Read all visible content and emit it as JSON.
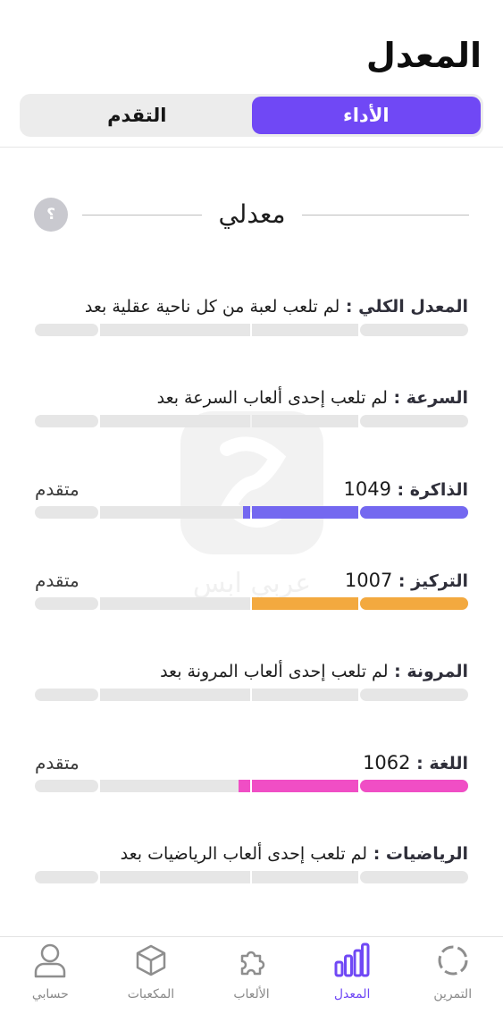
{
  "header": {
    "title": "المعدل"
  },
  "tabs": [
    {
      "id": "performance",
      "label": "الأداء",
      "active": true
    },
    {
      "id": "progress",
      "label": "التقدم",
      "active": false
    }
  ],
  "section": {
    "title": "معدلي",
    "help_label": "؟"
  },
  "watermark_text": "عربي ابس",
  "separator": " : ",
  "level_colors": {
    "empty": "#e6e6e6",
    "memory": "#7468f0",
    "focus": "#f3a93f",
    "language": "#f04ec5"
  },
  "metrics": [
    {
      "name": "المعدل الكلي",
      "value": "لم تلعب لعبة من كل ناحية عقلية بعد",
      "level": "",
      "fill": 0,
      "color": ""
    },
    {
      "name": "السرعة",
      "value": "لم تلعب إحدى ألعاب السرعة بعد",
      "level": "",
      "fill": 0,
      "color": ""
    },
    {
      "name": "الذاكرة",
      "value": "1049",
      "level": "متقدم",
      "fill": 0.52,
      "color": "#7468f0"
    },
    {
      "name": "التركيز",
      "value": "1007",
      "level": "متقدم",
      "fill": 0.5,
      "color": "#f3a93f"
    },
    {
      "name": "المرونة",
      "value": "لم تلعب إحدى ألعاب المرونة بعد",
      "level": "",
      "fill": 0,
      "color": ""
    },
    {
      "name": "اللغة",
      "value": "1062",
      "level": "متقدم",
      "fill": 0.53,
      "color": "#f04ec5"
    },
    {
      "name": "الرياضيات",
      "value": "لم تلعب إحدى ألعاب الرياضيات بعد",
      "level": "",
      "fill": 0,
      "color": ""
    }
  ],
  "nav": [
    {
      "id": "training",
      "label": "التمرين",
      "icon": "training-ring-icon",
      "active": false
    },
    {
      "id": "stats",
      "label": "المعدل",
      "icon": "bar-chart-icon",
      "active": true
    },
    {
      "id": "games",
      "label": "الألعاب",
      "icon": "puzzle-icon",
      "active": false
    },
    {
      "id": "cubes",
      "label": "المكعبات",
      "icon": "cube-icon",
      "active": false
    },
    {
      "id": "account",
      "label": "حسابي",
      "icon": "user-icon",
      "active": false
    }
  ]
}
